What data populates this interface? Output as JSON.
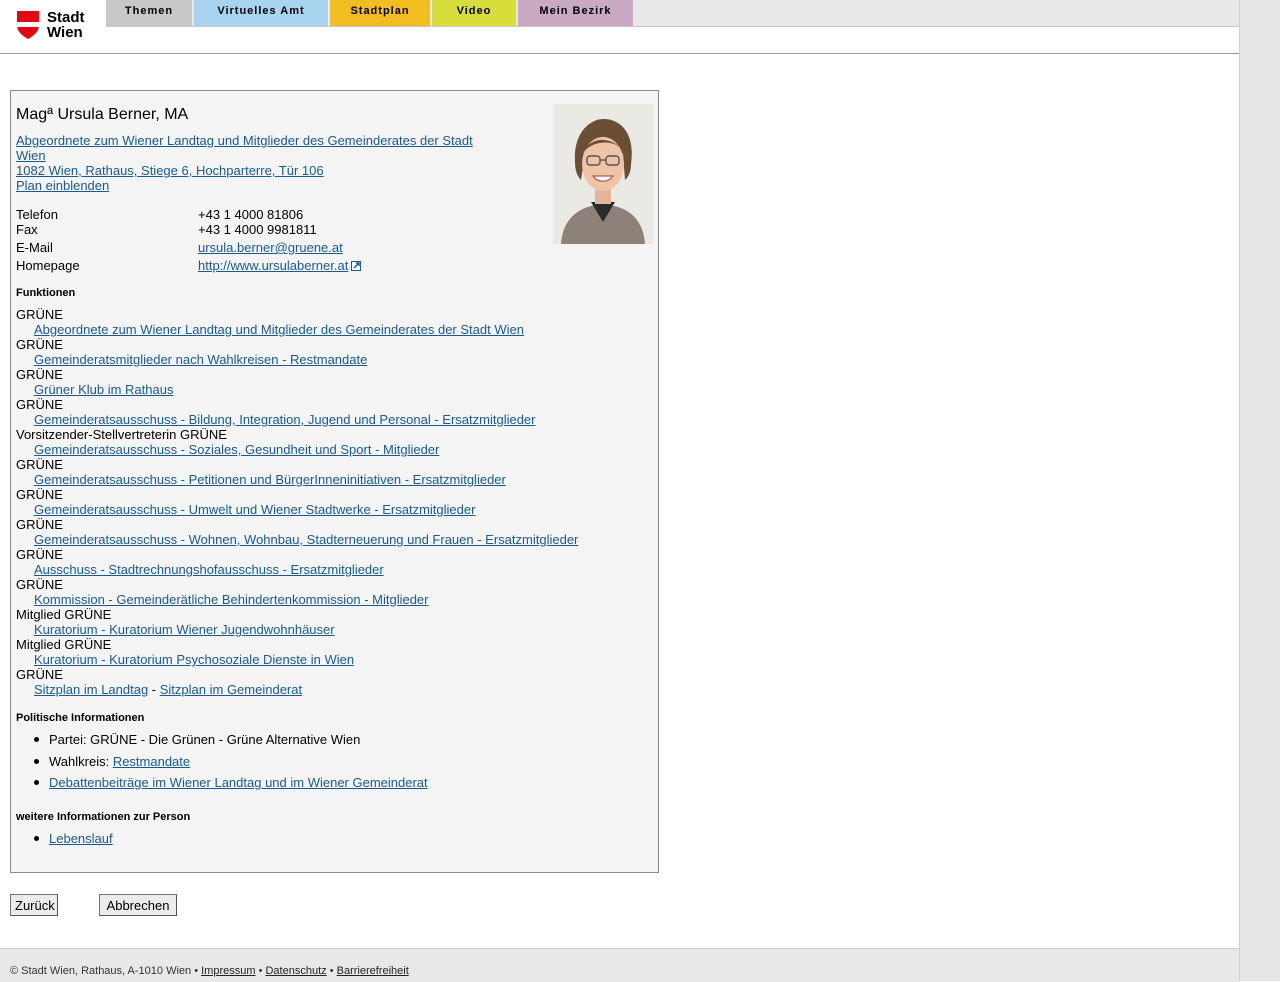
{
  "header": {
    "logo_line1": "Stadt",
    "logo_line2": "Wien",
    "tabs": [
      {
        "label": "Themen",
        "color": "#c8c8c8"
      },
      {
        "label": "Virtuelles Amt",
        "color": "#a8d4f0"
      },
      {
        "label": "Stadtplan",
        "color": "#f2bd20"
      },
      {
        "label": "Video",
        "color": "#d7dd3a"
      },
      {
        "label": "Mein Bezirk",
        "color": "#c9a9c4"
      }
    ]
  },
  "person": {
    "name": "Magª Ursula Berner, MA",
    "title_line1": "Abgeordnete zum Wiener Landtag und Mitglieder des Gemeinderates der Stadt",
    "title_line2": "Wien ",
    "address": "1082 Wien, Rathaus, Stiege 6, Hochparterre, Tür 106",
    "plan_link": "Plan einblenden"
  },
  "contact": {
    "telefon_label": "Telefon",
    "telefon": "+43 1 4000 81806",
    "fax_label": "Fax",
    "fax": "+43 1 4000 9981811",
    "email_label": "E-Mail",
    "email": "ursula.berner@gruene.at",
    "homepage_label": "Homepage",
    "homepage": "http://www.ursulaberner.at"
  },
  "funktionen": {
    "title": "Funktionen",
    "items": [
      {
        "role": "GRÜNE",
        "link": "Abgeordnete zum Wiener Landtag und Mitglieder des Gemeinderates der Stadt Wien"
      },
      {
        "role": "GRÜNE",
        "link": "Gemeinderatsmitglieder nach Wahlkreisen - Restmandate"
      },
      {
        "role": "GRÜNE",
        "link": "Grüner Klub im Rathaus"
      },
      {
        "role": "GRÜNE",
        "link": "Gemeinderatsausschuss - Bildung, Integration, Jugend und Personal - Ersatzmitglieder"
      },
      {
        "role": "Vorsitzender-Stellvertreterin GRÜNE",
        "link": "Gemeinderatsausschuss - Soziales, Gesundheit und Sport - Mitglieder"
      },
      {
        "role": "GRÜNE",
        "link": "Gemeinderatsausschuss - Petitionen und BürgerInneninitiativen - Ersatzmitglieder"
      },
      {
        "role": "GRÜNE",
        "link": "Gemeinderatsausschuss - Umwelt und Wiener Stadtwerke - Ersatzmitglieder"
      },
      {
        "role": "GRÜNE",
        "link": "Gemeinderatsausschuss - Wohnen, Wohnbau, Stadterneuerung und Frauen - Ersatzmitglieder"
      },
      {
        "role": "GRÜNE",
        "link": "Ausschuss - Stadtrechnungshofausschuss - Ersatzmitglieder"
      },
      {
        "role": "GRÜNE",
        "link": "Kommission - Gemeinderätliche Behindertenkommission - Mitglieder"
      },
      {
        "role": "Mitglied GRÜNE",
        "link": "Kuratorium - Kuratorium Wiener Jugendwohnhäuser"
      },
      {
        "role": "Mitglied GRÜNE",
        "link": "Kuratorium - Kuratorium Psychosoziale Dienste in Wien"
      }
    ],
    "last_role": "GRÜNE",
    "sitzplan_landtag": "Sitzplan im Landtag",
    "separator": " - ",
    "sitzplan_gemeinderat": "Sitzplan im Gemeinderat"
  },
  "politisch": {
    "title": "Politische Informationen",
    "partei": "Partei: GRÜNE - Die Grünen - Grüne Alternative Wien",
    "wahlkreis_label": "Wahlkreis: ",
    "wahlkreis_link": "Restmandate",
    "debatten_link": "Debattenbeiträge im Wiener Landtag und im Wiener Gemeinderat"
  },
  "weitere": {
    "title": "weitere Informationen zur Person",
    "lebenslauf": "Lebenslauf"
  },
  "buttons": {
    "back": "Zurück",
    "cancel": "Abbrechen"
  },
  "footer": {
    "copyright": "© Stadt Wien, Rathaus, A-1010 Wien • ",
    "impressum": "Impressum",
    "sep": " • ",
    "datenschutz": "Datenschutz",
    "barrierefreiheit": "Barrierefreiheit"
  }
}
